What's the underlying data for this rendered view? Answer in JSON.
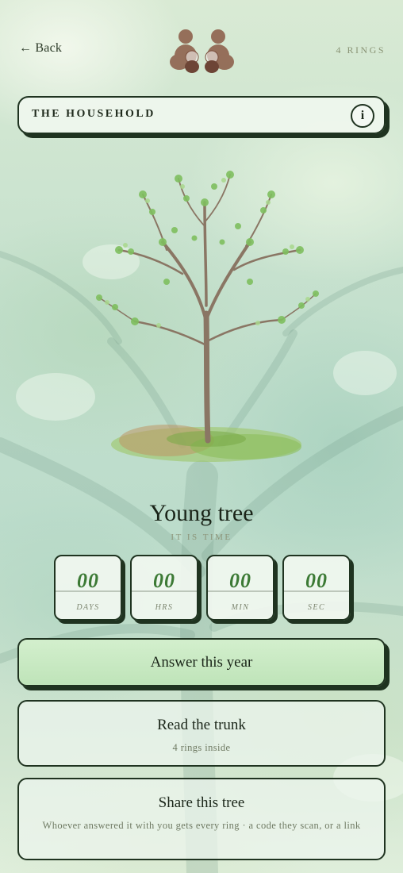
{
  "header": {
    "back_label": "← Back",
    "rings_label": "4 RINGS"
  },
  "household": {
    "title": "THE HOUSEHOLD",
    "info_label": "i"
  },
  "stage": {
    "title": "Young tree",
    "subtitle": "IT IS TIME"
  },
  "countdown": [
    {
      "value": "00",
      "unit": "DAYS"
    },
    {
      "value": "00",
      "unit": "HRS"
    },
    {
      "value": "00",
      "unit": "MIN"
    },
    {
      "value": "00",
      "unit": "SEC"
    }
  ],
  "actions": {
    "answer": {
      "label": "Answer this year"
    },
    "trunk": {
      "label": "Read the trunk",
      "sub": "4 rings inside"
    },
    "share": {
      "label": "Share this tree",
      "sub": "Whoever answered it with you gets every ring · a code they scan, or a link"
    }
  },
  "colors": {
    "ink": "#1f3320",
    "accent_green": "#3c7a35",
    "primary_fill": "#c9eac3",
    "muted_text": "#8a9476"
  },
  "icons": {
    "avatars": "household-members-icon",
    "info": "info-icon",
    "tree": "young-tree-illustration"
  }
}
